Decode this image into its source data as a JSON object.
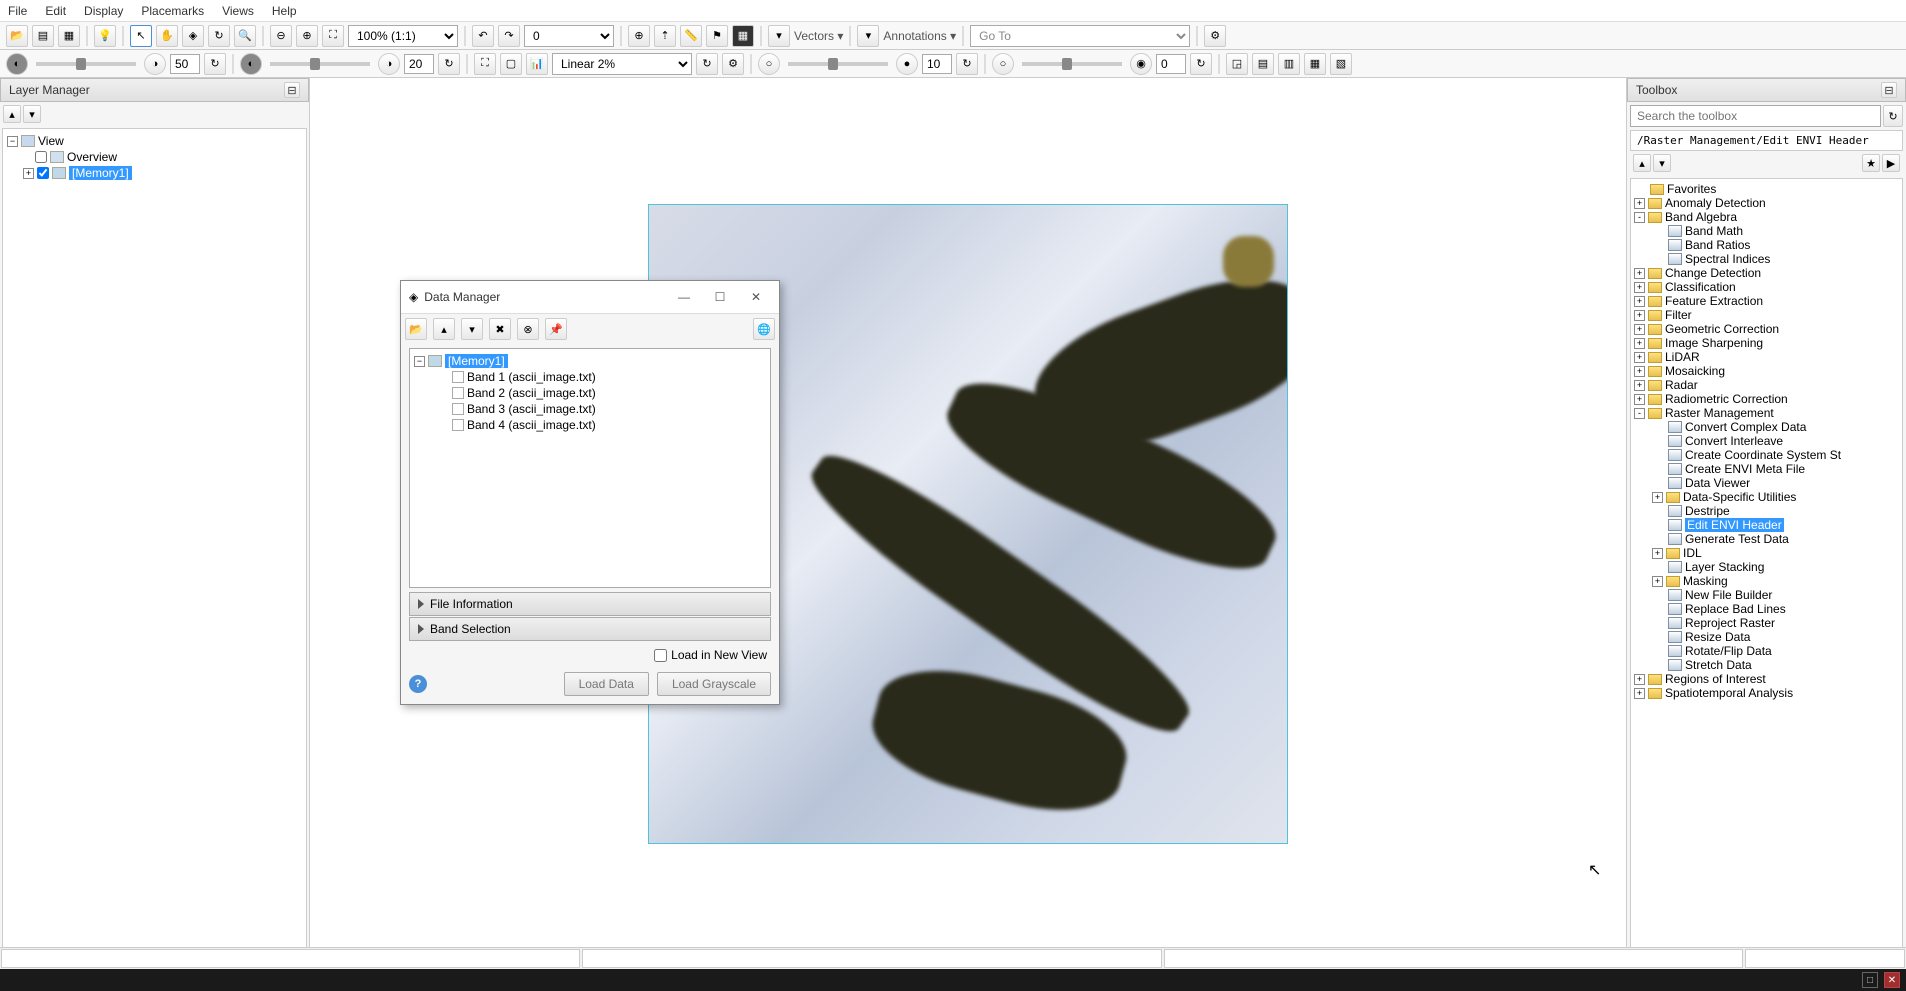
{
  "menu": {
    "file": "File",
    "edit": "Edit",
    "display": "Display",
    "placemarks": "Placemarks",
    "views": "Views",
    "help": "Help"
  },
  "toolbar1": {
    "zoom": "100% (1:1)",
    "rotation": "0",
    "vectors": "Vectors ▾",
    "annotations": "Annotations ▾",
    "goto": "Go To"
  },
  "toolbar2": {
    "val1": "50",
    "val2": "20",
    "stretch": "Linear 2%",
    "val3": "10",
    "val4": "0"
  },
  "layerManager": {
    "title": "Layer Manager",
    "view": "View",
    "overview": "Overview",
    "memory": "[Memory1]"
  },
  "toolbox": {
    "title": "Toolbox",
    "searchPlaceholder": "Search the toolbox",
    "path": "/Raster Management/Edit ENVI Header",
    "items": [
      {
        "t": "folder",
        "label": "Favorites",
        "exp": ""
      },
      {
        "t": "folder",
        "label": "Anomaly Detection",
        "exp": "+"
      },
      {
        "t": "folder",
        "label": "Band Algebra",
        "exp": "-",
        "children": [
          {
            "t": "tool",
            "label": "Band Math"
          },
          {
            "t": "tool",
            "label": "Band Ratios"
          },
          {
            "t": "tool",
            "label": "Spectral Indices"
          }
        ]
      },
      {
        "t": "folder",
        "label": "Change Detection",
        "exp": "+"
      },
      {
        "t": "folder",
        "label": "Classification",
        "exp": "+"
      },
      {
        "t": "folder",
        "label": "Feature Extraction",
        "exp": "+"
      },
      {
        "t": "folder",
        "label": "Filter",
        "exp": "+"
      },
      {
        "t": "folder",
        "label": "Geometric Correction",
        "exp": "+"
      },
      {
        "t": "folder",
        "label": "Image Sharpening",
        "exp": "+"
      },
      {
        "t": "folder",
        "label": "LiDAR",
        "exp": "+"
      },
      {
        "t": "folder",
        "label": "Mosaicking",
        "exp": "+"
      },
      {
        "t": "folder",
        "label": "Radar",
        "exp": "+"
      },
      {
        "t": "folder",
        "label": "Radiometric Correction",
        "exp": "+"
      },
      {
        "t": "folder",
        "label": "Raster Management",
        "exp": "-",
        "children": [
          {
            "t": "tool",
            "label": "Convert Complex Data"
          },
          {
            "t": "tool",
            "label": "Convert Interleave"
          },
          {
            "t": "tool",
            "label": "Create Coordinate System St"
          },
          {
            "t": "tool",
            "label": "Create ENVI Meta File"
          },
          {
            "t": "tool",
            "label": "Data Viewer"
          },
          {
            "t": "folder",
            "label": "Data-Specific Utilities",
            "exp": "+"
          },
          {
            "t": "tool",
            "label": "Destripe"
          },
          {
            "t": "tool",
            "label": "Edit ENVI Header",
            "selected": true
          },
          {
            "t": "tool",
            "label": "Generate Test Data"
          },
          {
            "t": "folder",
            "label": "IDL",
            "exp": "+"
          },
          {
            "t": "tool",
            "label": "Layer Stacking"
          },
          {
            "t": "folder",
            "label": "Masking",
            "exp": "+"
          },
          {
            "t": "tool",
            "label": "New File Builder"
          },
          {
            "t": "tool",
            "label": "Replace Bad Lines"
          },
          {
            "t": "tool",
            "label": "Reproject Raster"
          },
          {
            "t": "tool",
            "label": "Resize Data"
          },
          {
            "t": "tool",
            "label": "Rotate/Flip Data"
          },
          {
            "t": "tool",
            "label": "Stretch Data"
          }
        ]
      },
      {
        "t": "folder",
        "label": "Regions of Interest",
        "exp": "+"
      },
      {
        "t": "folder",
        "label": "Spatiotemporal Analysis",
        "exp": "+"
      }
    ]
  },
  "dataManager": {
    "title": "Data Manager",
    "root": "[Memory1]",
    "bands": [
      "Band 1 (ascii_image.txt)",
      "Band 2 (ascii_image.txt)",
      "Band 3 (ascii_image.txt)",
      "Band 4 (ascii_image.txt)"
    ],
    "fileInfo": "File Information",
    "bandSelection": "Band Selection",
    "loadInNewView": "Load in New View",
    "loadData": "Load Data",
    "loadGrayscale": "Load Grayscale"
  }
}
